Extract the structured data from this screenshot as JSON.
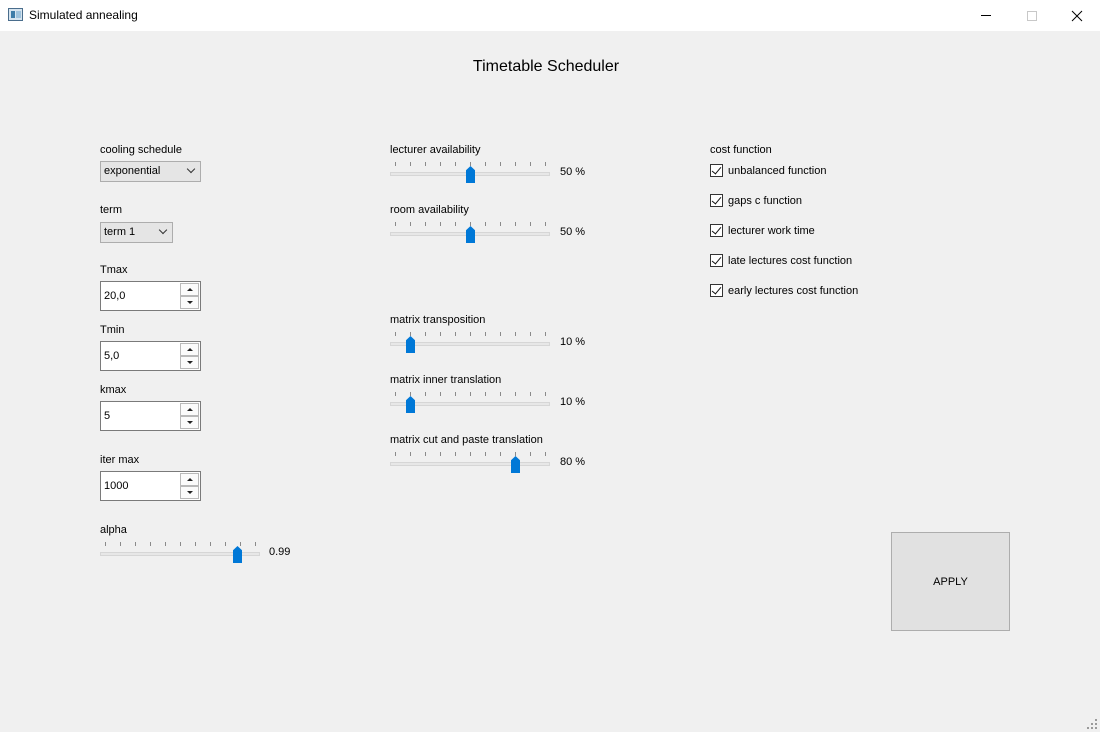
{
  "window": {
    "title": "Simulated annealing"
  },
  "page_title": "Timetable Scheduler",
  "left": {
    "cooling_schedule": {
      "label": "cooling schedule",
      "value": "exponential"
    },
    "term": {
      "label": "term",
      "value": "term 1"
    },
    "tmax": {
      "label": "Tmax",
      "value": "20,0"
    },
    "tmin": {
      "label": "Tmin",
      "value": "5,0"
    },
    "kmax": {
      "label": "kmax",
      "value": "5"
    },
    "iter_max": {
      "label": "iter max",
      "value": "1000"
    },
    "alpha": {
      "label": "alpha",
      "value_text": "0.99",
      "position": 0.88
    }
  },
  "middle": {
    "lecturer_availability": {
      "label": "lecturer availability",
      "value_text": "50 %",
      "percent": 50
    },
    "room_availability": {
      "label": "room availability",
      "value_text": "50 %",
      "percent": 50
    },
    "matrix_transposition": {
      "label": "matrix transposition",
      "value_text": "10 %",
      "percent": 10
    },
    "matrix_inner_translation": {
      "label": "matrix inner translation",
      "value_text": "10 %",
      "percent": 10
    },
    "matrix_cut_paste": {
      "label": "matrix cut and paste translation",
      "value_text": "80 %",
      "percent": 80
    }
  },
  "cost_function": {
    "label": "cost function",
    "items": [
      {
        "label": "unbalanced function",
        "checked": true
      },
      {
        "label": "gaps c function",
        "checked": true
      },
      {
        "label": "lecturer work time",
        "checked": true
      },
      {
        "label": "late lectures cost function",
        "checked": true
      },
      {
        "label": "early lectures cost function",
        "checked": true
      }
    ]
  },
  "apply_button": {
    "label": "APPLY"
  },
  "colors": {
    "background": "#f0f0f0",
    "slider_thumb": "#0078d7",
    "button_face": "#e1e1e1"
  }
}
